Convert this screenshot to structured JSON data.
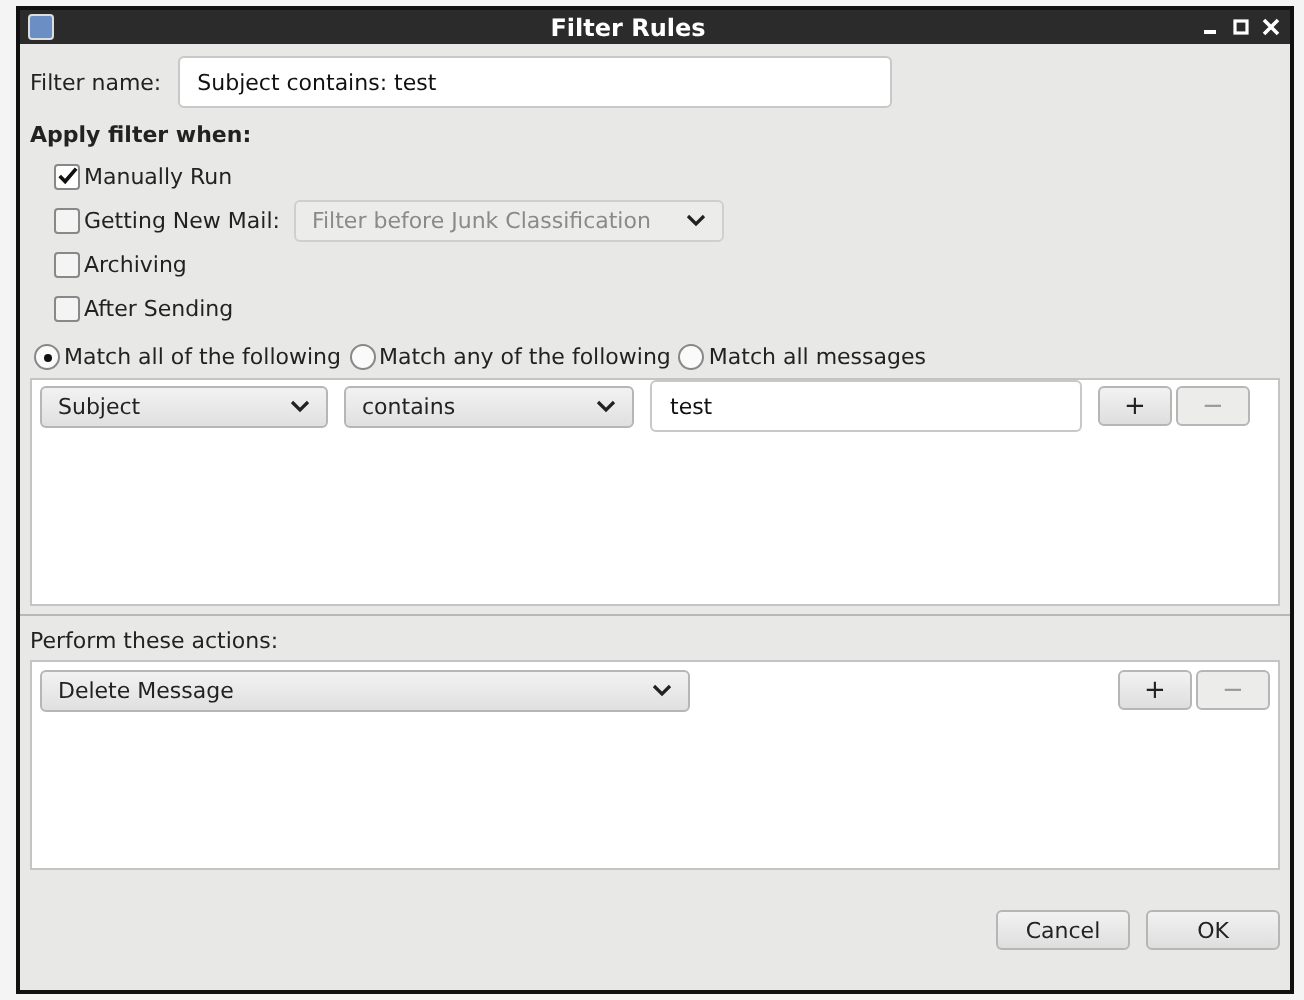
{
  "window": {
    "title": "Filter Rules"
  },
  "filter_name": {
    "label": "Filter name:",
    "value": "Subject contains: test"
  },
  "apply_when": {
    "heading": "Apply filter when:",
    "options": [
      {
        "label": "Manually Run",
        "checked": true
      },
      {
        "label": "Getting New Mail:",
        "checked": false,
        "dropdown": {
          "value": "Filter before Junk Classification",
          "disabled": true
        }
      },
      {
        "label": "Archiving",
        "checked": false
      },
      {
        "label": "After Sending",
        "checked": false
      }
    ]
  },
  "match": [
    {
      "label": "Match all of the following",
      "selected": true
    },
    {
      "label": "Match any of the following",
      "selected": false
    },
    {
      "label": "Match all messages",
      "selected": false
    }
  ],
  "rules": [
    {
      "field": "Subject",
      "operator": "contains",
      "value": "test",
      "add": "+",
      "remove": "−",
      "remove_disabled": true
    }
  ],
  "actions": {
    "heading": "Perform these actions:",
    "items": [
      {
        "action": "Delete Message",
        "add": "+",
        "remove": "−",
        "remove_disabled": true
      }
    ]
  },
  "buttons": [
    {
      "label": "Cancel"
    },
    {
      "label": "OK"
    }
  ]
}
